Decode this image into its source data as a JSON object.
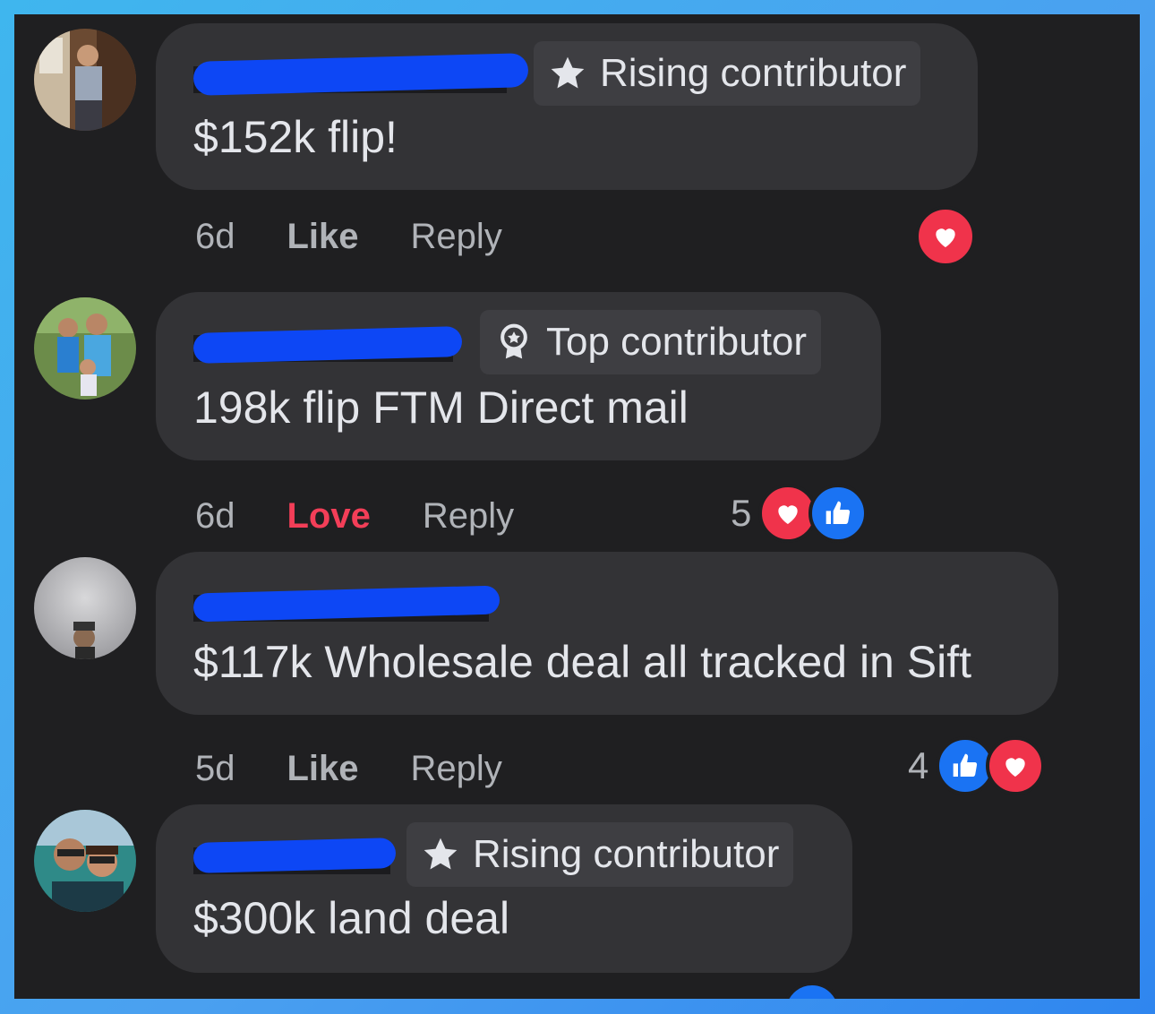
{
  "comments": [
    {
      "badge": "Rising contributor",
      "badge_icon": "star-icon",
      "text": "$152k flip!",
      "time": "6d",
      "reaction_action": "Like",
      "reply": "Reply",
      "reaction_count": "",
      "reactions": [
        "heart"
      ]
    },
    {
      "badge": "Top contributor",
      "badge_icon": "award-icon",
      "text": "198k flip FTM Direct mail",
      "time": "6d",
      "reaction_action": "Love",
      "reply": "Reply",
      "reaction_count": "5",
      "reactions": [
        "heart",
        "thumb"
      ]
    },
    {
      "badge": "",
      "badge_icon": "",
      "text": "$117k Wholesale deal all tracked in Sift",
      "time": "5d",
      "reaction_action": "Like",
      "reply": "Reply",
      "reaction_count": "4",
      "reactions": [
        "thumb",
        "heart"
      ]
    },
    {
      "badge": "Rising contributor",
      "badge_icon": "star-icon",
      "text": "$300k land deal",
      "time": "",
      "reaction_action": "",
      "reply": "",
      "reaction_count": "",
      "reactions": []
    }
  ],
  "colors": {
    "panel_bg": "#1f1f21",
    "bubble_bg": "#333336",
    "love_red": "#f33e58",
    "like_blue": "#1a73f3",
    "redaction_blue": "#0d47f5"
  }
}
